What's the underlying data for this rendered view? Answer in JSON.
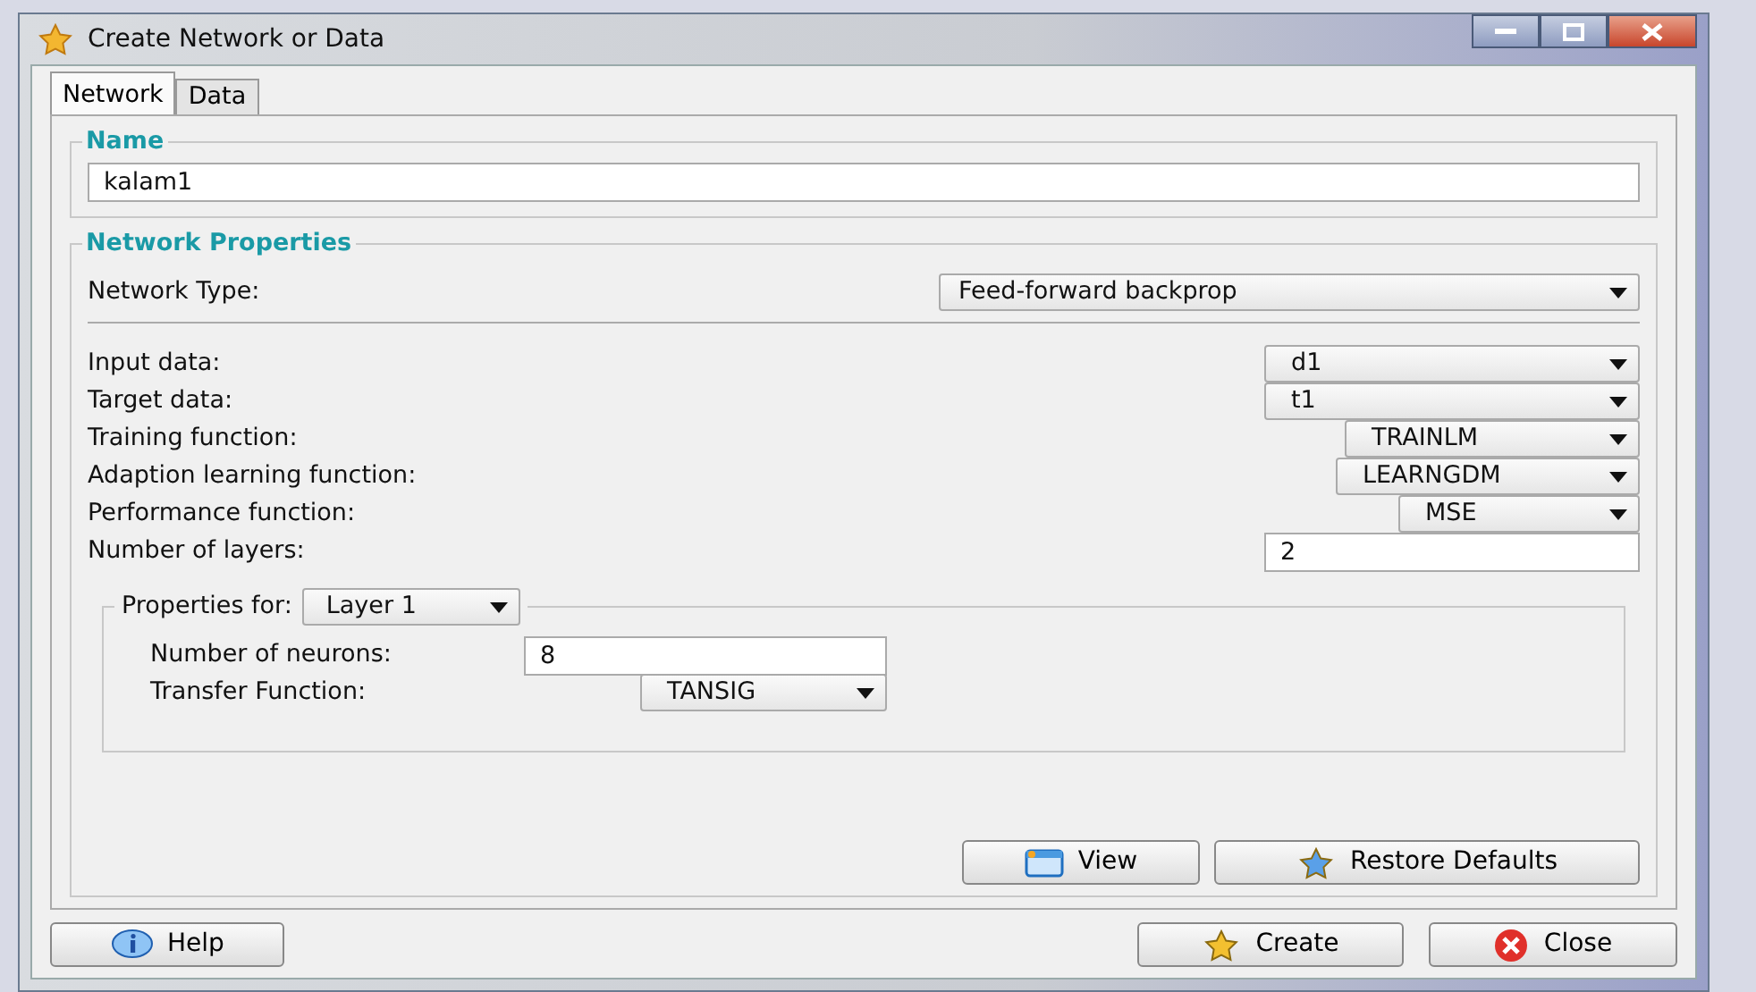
{
  "window": {
    "title": "Create Network or Data"
  },
  "tabs": [
    {
      "label": "Network",
      "selected": true
    },
    {
      "label": "Data",
      "selected": false
    }
  ],
  "name_section": {
    "legend": "Name",
    "value": "kalam1"
  },
  "network_properties": {
    "legend": "Network Properties",
    "network_type": {
      "label": "Network Type:",
      "value": "Feed-forward backprop"
    },
    "fields": [
      {
        "kind": "dropdown",
        "label": "Input data:",
        "value": "d1"
      },
      {
        "kind": "dropdown",
        "label": "Target data:",
        "value": "t1"
      },
      {
        "kind": "dropdown",
        "label": "Training function:",
        "value": "TRAINLM"
      },
      {
        "kind": "dropdown",
        "label": "Adaption learning function:",
        "value": "LEARNGDM"
      },
      {
        "kind": "dropdown",
        "label": "Performance function:",
        "value": "MSE"
      },
      {
        "kind": "input",
        "label": "Number of layers:",
        "value": "2"
      }
    ]
  },
  "layer_properties": {
    "label": "Properties for:",
    "layer": "Layer 1",
    "fields": [
      {
        "kind": "input",
        "label": "Number of neurons:",
        "value": "8"
      },
      {
        "kind": "dropdown",
        "label": "Transfer Function:",
        "value": "TANSIG"
      }
    ]
  },
  "panel_buttons": [
    {
      "label": "View"
    },
    {
      "label": "Restore Defaults"
    }
  ],
  "footer_buttons": [
    {
      "label": "Help"
    },
    {
      "label": "Create"
    },
    {
      "label": "Close"
    }
  ]
}
